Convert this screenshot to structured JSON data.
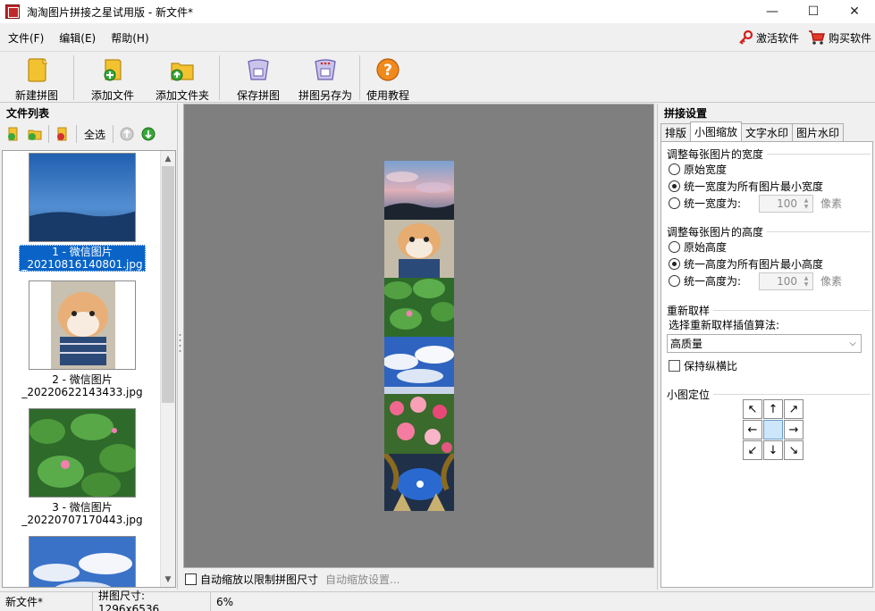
{
  "window": {
    "title": "淘淘图片拼接之星试用版 - 新文件*",
    "minimize": "—",
    "maximize": "☐",
    "close": "✕"
  },
  "menu": {
    "file": "文件(F)",
    "edit": "编辑(E)",
    "help": "帮助(H)",
    "activate": "激活软件",
    "buy": "购买软件"
  },
  "toolbar": {
    "new": "新建拼图",
    "add_file": "添加文件",
    "add_folder": "添加文件夹",
    "save": "保存拼图",
    "save_as": "拼图另存为",
    "tutorial": "使用教程"
  },
  "file_panel": {
    "title": "文件列表",
    "select_all": "全选",
    "items": [
      {
        "line1": "1 - 微信图片",
        "line2": "_20210816140801.jpg",
        "selected": true
      },
      {
        "line1": "2 - 微信图片",
        "line2": "_20220622143433.jpg",
        "selected": false
      },
      {
        "line1": "3 - 微信图片",
        "line2": "_20220707170443.jpg",
        "selected": false
      }
    ]
  },
  "canvas": {
    "auto_zoom_label": "自动缩放以限制拼图尺寸",
    "auto_zoom_settings": "自动缩放设置..."
  },
  "settings": {
    "title": "拼接设置",
    "tabs": [
      "排版",
      "小图缩放",
      "文字水印",
      "图片水印"
    ],
    "active_tab": "小图缩放",
    "width_group": {
      "title": "调整每张图片的宽度",
      "opt1": "原始宽度",
      "opt2": "统一宽度为所有图片最小宽度",
      "opt3": "统一宽度为:",
      "value": "100",
      "unit": "像素",
      "selected": 2
    },
    "height_group": {
      "title": "调整每张图片的高度",
      "opt1": "原始高度",
      "opt2": "统一高度为所有图片最小高度",
      "opt3": "统一高度为:",
      "value": "100",
      "unit": "像素",
      "selected": 2
    },
    "resample": {
      "title": "重新取样",
      "label": "选择重新取样插值算法:",
      "value": "高质量",
      "keep_ratio": "保持纵横比",
      "keep_ratio_checked": false
    },
    "position": {
      "title": "小图定位",
      "arrows": [
        "↖",
        "↑",
        "↗",
        "←",
        "",
        "→",
        "↙",
        "↓",
        "↘"
      ]
    }
  },
  "status": {
    "file": "新文件*",
    "size": "拼图尺寸: 1296x6536",
    "zoom": "6%"
  }
}
